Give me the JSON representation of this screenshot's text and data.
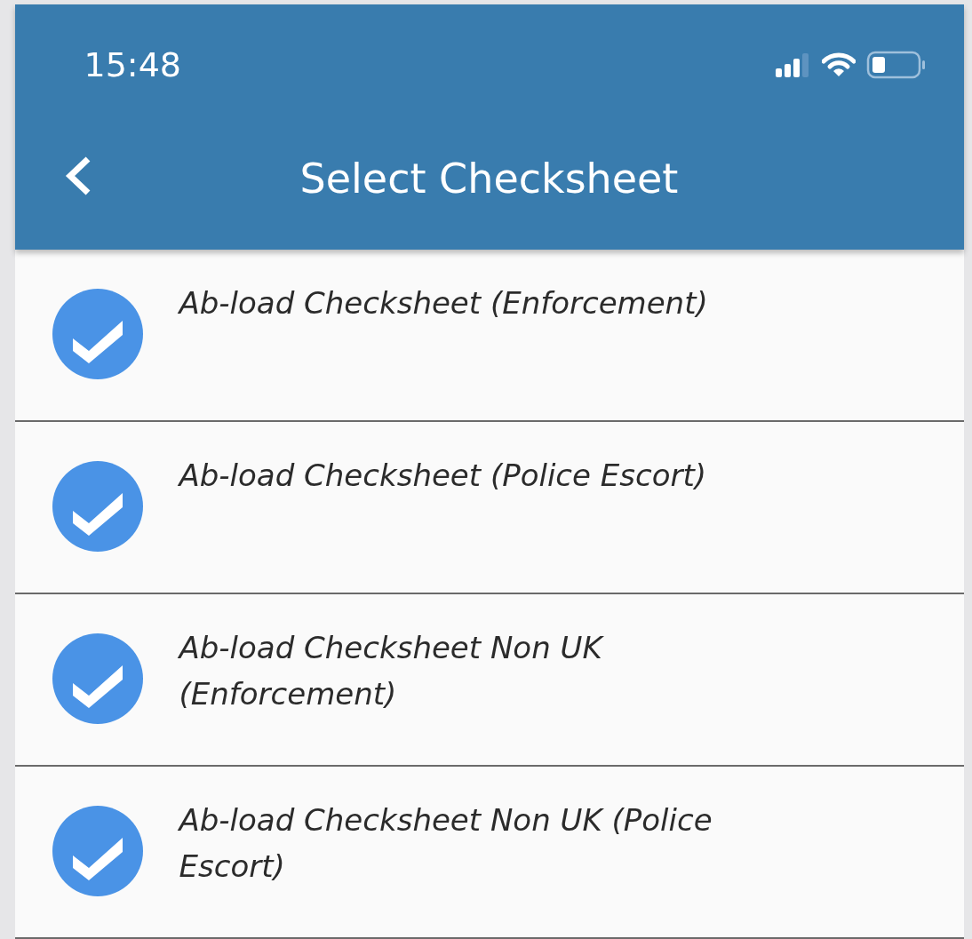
{
  "status_bar": {
    "time": "15:48"
  },
  "nav_bar": {
    "title": "Select Checksheet"
  },
  "items": [
    {
      "label": "Ab-load Checksheet (Enforcement)",
      "checked": true
    },
    {
      "label": "Ab-load Checksheet (Police Escort)",
      "checked": true
    },
    {
      "label": "Ab-load Checksheet Non UK (Enforcement)",
      "checked": true
    },
    {
      "label": "Ab-load Checksheet Non UK (Police Escort)",
      "checked": true
    }
  ]
}
